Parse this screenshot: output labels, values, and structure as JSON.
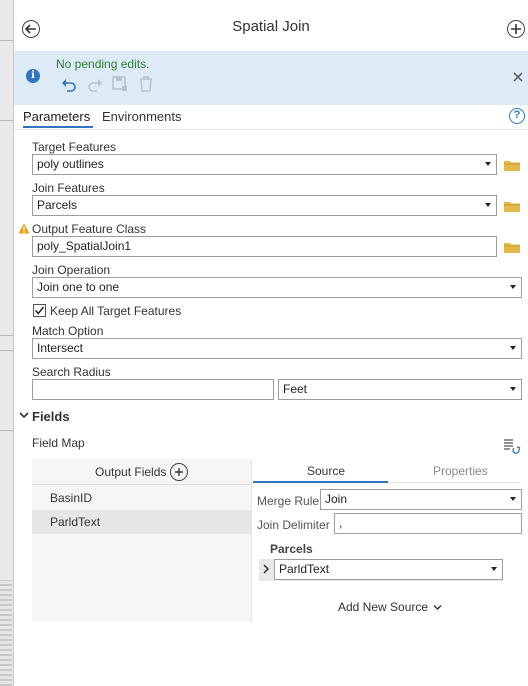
{
  "title": "Spatial Join",
  "message": "No pending edits.",
  "tabs": [
    "Parameters",
    "Environments"
  ],
  "params": {
    "target_features_label": "Target Features",
    "target_features_value": "poly outlines",
    "join_features_label": "Join Features",
    "join_features_value": "Parcels",
    "output_class_label": "Output Feature Class",
    "output_class_value": "poly_SpatialJoin1",
    "join_operation_label": "Join Operation",
    "join_operation_value": "Join one to one",
    "keep_all_label": "Keep All Target Features",
    "keep_all_checked": true,
    "match_option_label": "Match Option",
    "match_option_value": "Intersect",
    "search_radius_label": "Search Radius",
    "search_radius_value": "",
    "search_radius_unit": "Feet"
  },
  "fields": {
    "section_title": "Fields",
    "field_map_label": "Field Map",
    "output_fields_header": "Output Fields",
    "output_fields": [
      "BasinID",
      "ParldText"
    ],
    "source_tab": "Source",
    "properties_tab": "Properties",
    "merge_rule_label": "Merge Rule",
    "merge_rule_value": "Join",
    "join_delimiter_label": "Join Delimiter",
    "join_delimiter_value": ",",
    "source_group": "Parcels",
    "source_field": "ParldText",
    "add_new_source": "Add New Source"
  },
  "colors": {
    "accent": "#2f76c0",
    "message_bg": "#dcebf5",
    "message_text": "#2e7d32",
    "warning": "#e8a317",
    "folder": "#e4b84a"
  },
  "icons": [
    "back-arrow-icon",
    "add-circle-icon",
    "info-icon",
    "undo-icon",
    "redo-icon",
    "save-edits-icon",
    "discard-edits-icon",
    "close-icon",
    "help-icon",
    "folder-icon",
    "warning-icon",
    "chevron-down-icon",
    "field-map-options-icon",
    "chevron-right-icon"
  ]
}
